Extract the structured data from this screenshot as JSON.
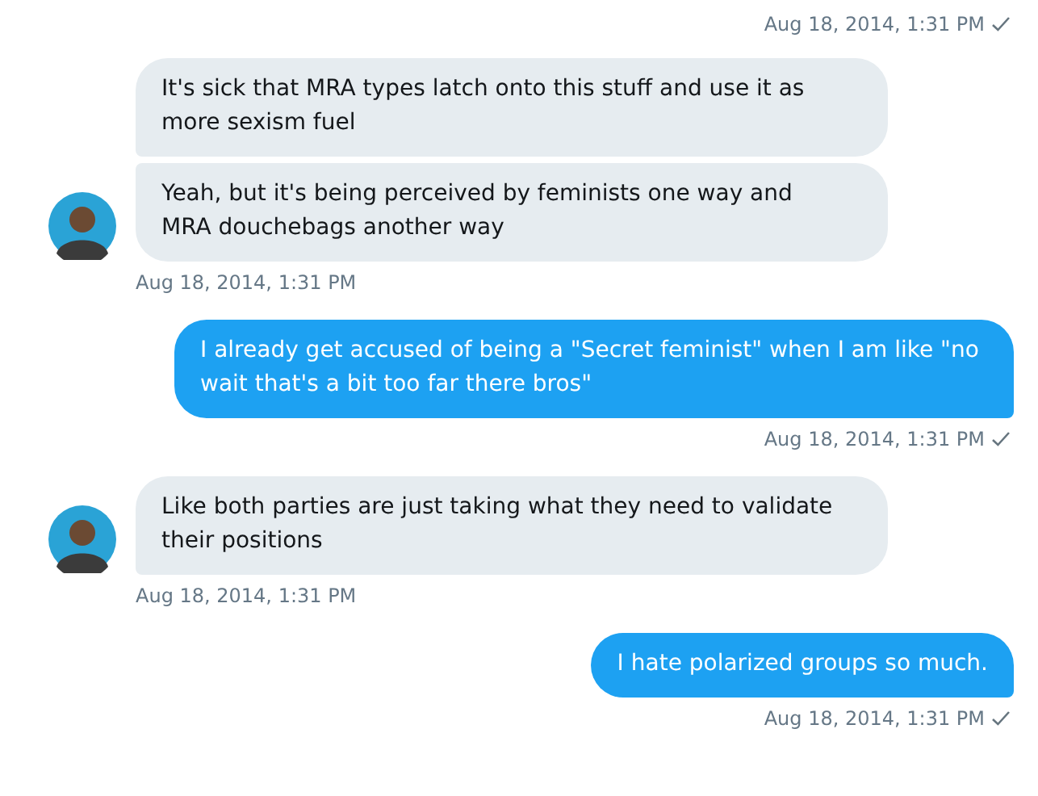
{
  "groups": [
    {
      "kind": "sent",
      "timestamp": "Aug 18, 2014, 1:31 PM",
      "read": true
    },
    {
      "kind": "received",
      "messages": [
        "It's sick that MRA types latch onto this stuff and use it as more sexism fuel",
        "Yeah, but it's being perceived by feminists one way and MRA douchebags another way"
      ],
      "timestamp": "Aug 18, 2014, 1:31 PM",
      "read": false
    },
    {
      "kind": "sent",
      "messages": [
        "I already get accused of being a \"Secret feminist\" when I am like \"no wait that's a bit too far there bros\""
      ],
      "timestamp": "Aug 18, 2014, 1:31 PM",
      "read": true
    },
    {
      "kind": "received",
      "messages": [
        "Like both parties are just taking what they need to validate their positions"
      ],
      "timestamp": "Aug 18, 2014, 1:31 PM",
      "read": false
    },
    {
      "kind": "sent",
      "messages": [
        "I hate polarized groups so much."
      ],
      "timestamp": "Aug 18, 2014, 1:31 PM",
      "read": true
    }
  ]
}
